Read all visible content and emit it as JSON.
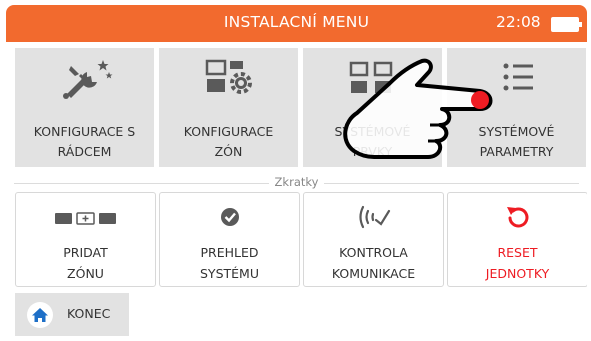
{
  "header": {
    "title": "INSTALACNÍ MENU",
    "time": "22:08"
  },
  "menu": [
    {
      "icon": "tools-icon",
      "line1": "KONFIGURACE S",
      "line2": "RÁDCEM"
    },
    {
      "icon": "zone-config-icon",
      "line1": "KONFIGURACE",
      "line2": "ZÓN"
    },
    {
      "icon": "system-devices-icon",
      "line1": "SYSTÉMOVÉ",
      "line2": "PRVKY"
    },
    {
      "icon": "list-icon",
      "line1": "SYSTÉMOVÉ",
      "line2": "PARAMETRY"
    }
  ],
  "shortcuts": {
    "label": "Zkratky",
    "items": [
      {
        "icon": "add-zone-icon",
        "line1": "PRIDAT",
        "line2": "ZÓNU"
      },
      {
        "icon": "check-icon",
        "line1": "PREHLED",
        "line2": "SYSTÉMU"
      },
      {
        "icon": "signal-icon",
        "line1": "KONTROLA",
        "line2": "KOMUNIKACE"
      },
      {
        "icon": "reset-icon",
        "line1": "RESET",
        "line2": "JEDNOTKY"
      }
    ]
  },
  "end_button": {
    "label": "KONEC",
    "icon": "home-icon"
  },
  "overlay": {
    "icon": "pointing-hand-icon"
  },
  "colors": {
    "accent": "#f26a2e",
    "tile": "#e2e2e2",
    "reset": "#ee1c23",
    "home": "#1e6fc7",
    "icon_gray": "#5a5a5a"
  }
}
